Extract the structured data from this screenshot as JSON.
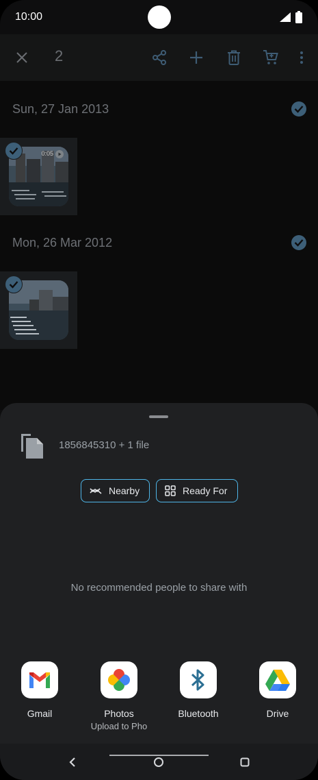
{
  "status_bar": {
    "time": "10:00"
  },
  "app_bar": {
    "selected_count": "2"
  },
  "groups": [
    {
      "date": "Sun, 27 Jan 2013",
      "thumb_duration": "0:05"
    },
    {
      "date": "Mon, 26 Mar 2012"
    }
  ],
  "share_sheet": {
    "file_summary": "1856845310 + 1 file",
    "chips": [
      {
        "label": "Nearby",
        "icon": "nearby-icon"
      },
      {
        "label": "Ready For",
        "icon": "grid-icon"
      }
    ],
    "empty_message": "No recommended people to share with",
    "apps": [
      {
        "name": "Gmail",
        "subtitle": ""
      },
      {
        "name": "Photos",
        "subtitle": "Upload to Pho"
      },
      {
        "name": "Bluetooth",
        "subtitle": ""
      },
      {
        "name": "Drive",
        "subtitle": ""
      }
    ]
  },
  "colors": {
    "accent": "#4fb6e8",
    "check": "#3d5f78",
    "sheet_bg": "#1f2022"
  }
}
